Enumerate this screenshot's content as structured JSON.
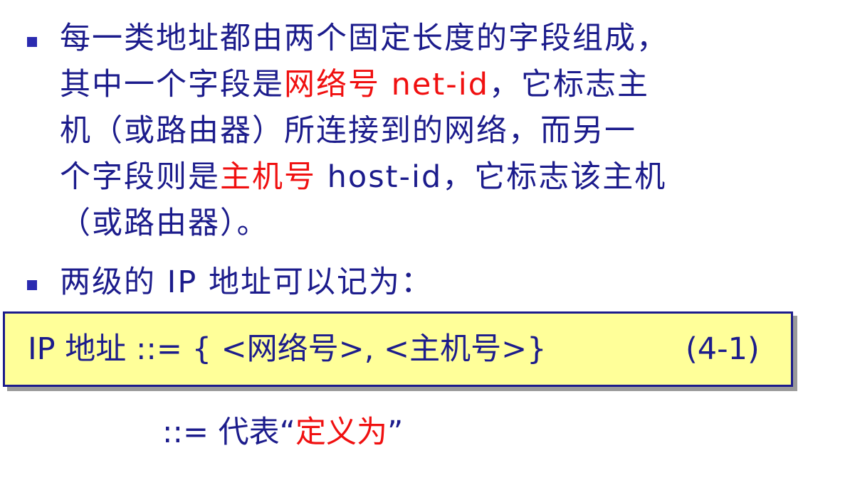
{
  "colors": {
    "text": "#1c1c8c",
    "highlight": "#f01010",
    "bullet": "#2b2bb0",
    "box_fill": "#ffff99",
    "box_border": "#1c1c8c",
    "box_shadow": "#9a9a9a"
  },
  "bullet1": {
    "line1": "每一类地址都由两个固定长度的字段组成，",
    "line2_a": "其中一个字段是",
    "line2_hl": "网络号  net-id",
    "line2_b": "，它标志主",
    "line3": "机（或路由器）所连接到的网络，而另一",
    "line4_a": "个字段则是",
    "line4_hl": "主机号",
    "line4_b": "  host-id，它标志该主机",
    "line5": "（或路由器）。"
  },
  "bullet2": {
    "text": "两级的 IP 地址可以记为："
  },
  "formula": {
    "expr": "IP 地址 ::= { <网络号>, <主机号>}",
    "number": "(4-1)"
  },
  "note": {
    "prefix": "::= 代表“",
    "highlight": "定义为",
    "suffix": "”"
  }
}
